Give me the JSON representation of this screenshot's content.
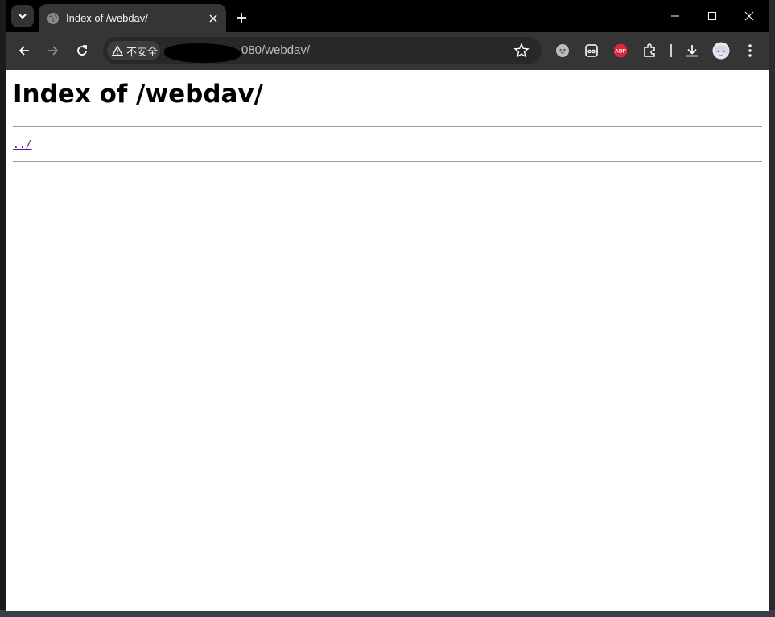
{
  "tab": {
    "title": "Index of /webdav/"
  },
  "address_bar": {
    "security_label": "不安全",
    "url_visible": "080/webdav/"
  },
  "extensions": {
    "abp_label": "ABP"
  },
  "page": {
    "heading": "Index of /webdav/",
    "parent_link": "../"
  }
}
